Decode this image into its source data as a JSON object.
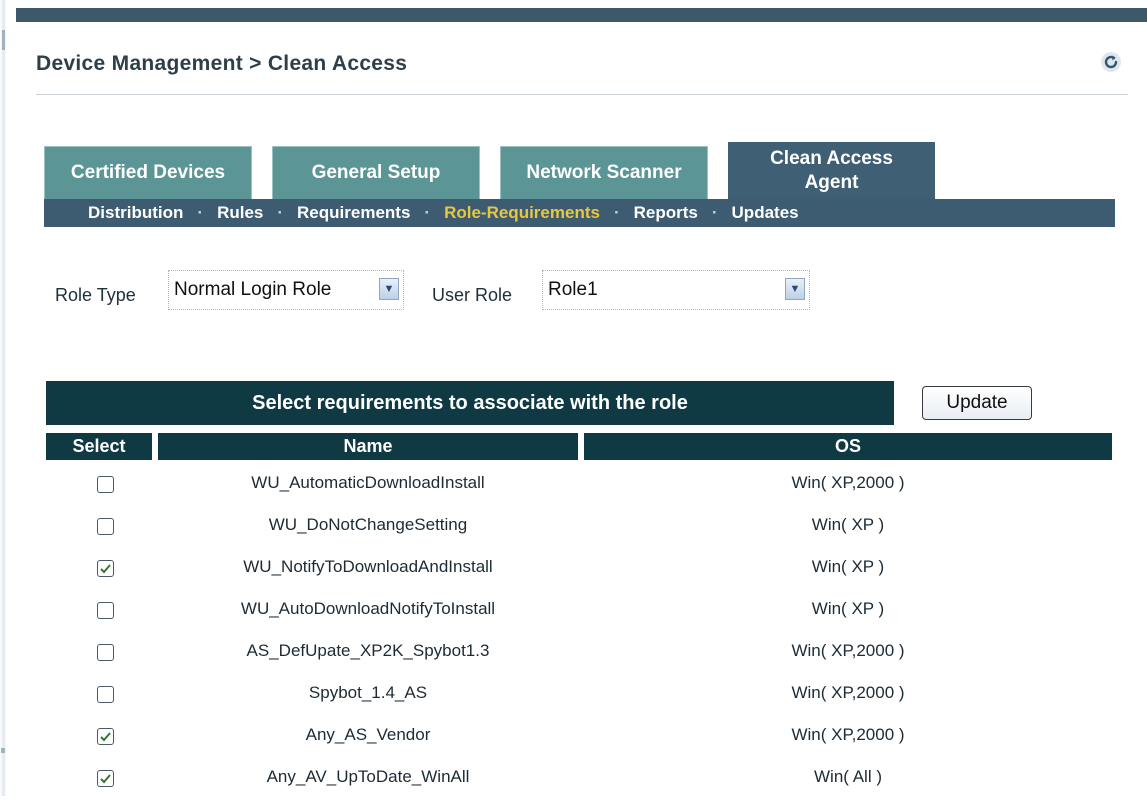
{
  "breadcrumb": "Device Management > Clean Access",
  "tabs": [
    {
      "label": "Certified Devices",
      "active": false
    },
    {
      "label": "General Setup",
      "active": false
    },
    {
      "label": "Network Scanner",
      "active": false
    },
    {
      "label": "Clean Access Agent",
      "active": true
    }
  ],
  "subnav": [
    "Distribution",
    "Rules",
    "Requirements",
    "Role-Requirements",
    "Reports",
    "Updates"
  ],
  "subnav_current": "Role-Requirements",
  "subnav_separator": "·",
  "filters": {
    "role_type_label": "Role Type",
    "role_type_value": "Normal Login Role",
    "user_role_label": "User Role",
    "user_role_value": "Role1"
  },
  "requirements_header": "Select requirements to associate with the role",
  "update_label": "Update",
  "columns": {
    "select": "Select",
    "name": "Name",
    "os": "OS"
  },
  "rows": [
    {
      "checked": false,
      "name": "WU_AutomaticDownloadInstall",
      "os": "Win( XP,2000 )"
    },
    {
      "checked": false,
      "name": "WU_DoNotChangeSetting",
      "os": "Win( XP )"
    },
    {
      "checked": true,
      "name": "WU_NotifyToDownloadAndInstall",
      "os": "Win( XP )"
    },
    {
      "checked": false,
      "name": "WU_AutoDownloadNotifyToInstall",
      "os": "Win( XP )"
    },
    {
      "checked": false,
      "name": "AS_DefUpate_XP2K_Spybot1.3",
      "os": "Win( XP,2000 )"
    },
    {
      "checked": false,
      "name": "Spybot_1.4_AS",
      "os": "Win( XP,2000 )"
    },
    {
      "checked": true,
      "name": "Any_AS_Vendor",
      "os": "Win( XP,2000 )"
    },
    {
      "checked": true,
      "name": "Any_AV_UpToDate_WinAll",
      "os": "Win( All )"
    }
  ],
  "colors": {
    "dark_header": "#0f3a44",
    "tab_inactive": "#5c9595",
    "tab_active": "#3f5f75",
    "subnav_current": "#e9c640"
  }
}
